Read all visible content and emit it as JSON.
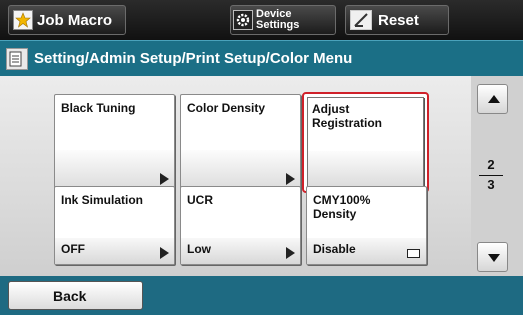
{
  "topbar": {
    "job_macro": "Job Macro",
    "device_settings_line1": "Device",
    "device_settings_line2": "Settings",
    "reset": "Reset"
  },
  "breadcrumb": "Setting/Admin Setup/Print Setup/Color Menu",
  "tiles": [
    {
      "label": "Black Tuning",
      "value": ""
    },
    {
      "label": "Color Density",
      "value": ""
    },
    {
      "label": "Adjust Registration",
      "value": ""
    },
    {
      "label": "Ink Simulation",
      "value": "OFF"
    },
    {
      "label": "UCR",
      "value": "Low"
    },
    {
      "label": "CMY100% Density",
      "value": "Disable"
    }
  ],
  "pagination": {
    "current": "2",
    "total": "3"
  },
  "back": "Back",
  "colors": {
    "header": "#1b6f86",
    "selected_border": "#d0212a"
  }
}
